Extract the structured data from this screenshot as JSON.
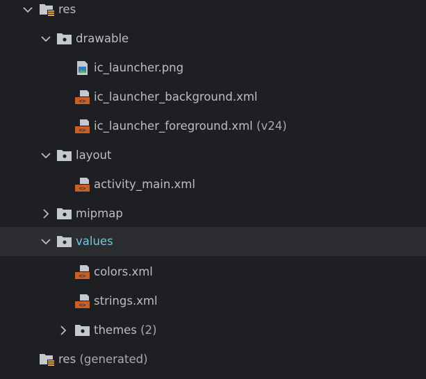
{
  "tree": {
    "res": {
      "label": "res"
    },
    "drawable": {
      "label": "drawable"
    },
    "ic_launcher_png": {
      "label": "ic_launcher.png"
    },
    "ic_launcher_background": {
      "label": "ic_launcher_background.xml"
    },
    "ic_launcher_foreground": {
      "label": "ic_launcher_foreground.xml",
      "suffix": "(v24)"
    },
    "layout": {
      "label": "layout"
    },
    "activity_main": {
      "label": "activity_main.xml"
    },
    "mipmap": {
      "label": "mipmap"
    },
    "values": {
      "label": "values"
    },
    "colors": {
      "label": "colors.xml"
    },
    "strings": {
      "label": "strings.xml"
    },
    "themes": {
      "label": "themes",
      "suffix": "(2)"
    },
    "res_generated": {
      "label": "res",
      "suffix": "(generated)"
    }
  },
  "colors": {
    "background": "#1e1f22",
    "selected_row": "#2b2d30",
    "selected_text": "#6fc9db",
    "text": "#bcbec4",
    "xml_icon": "#c75f29",
    "folder_icon": "#c5c8ce"
  },
  "icons": {
    "expanded": "chevron-down-icon",
    "collapsed": "chevron-right-icon",
    "resource_root": "resource-folder-icon",
    "folder": "folder-icon",
    "image": "image-file-icon",
    "xml": "xml-file-icon"
  }
}
